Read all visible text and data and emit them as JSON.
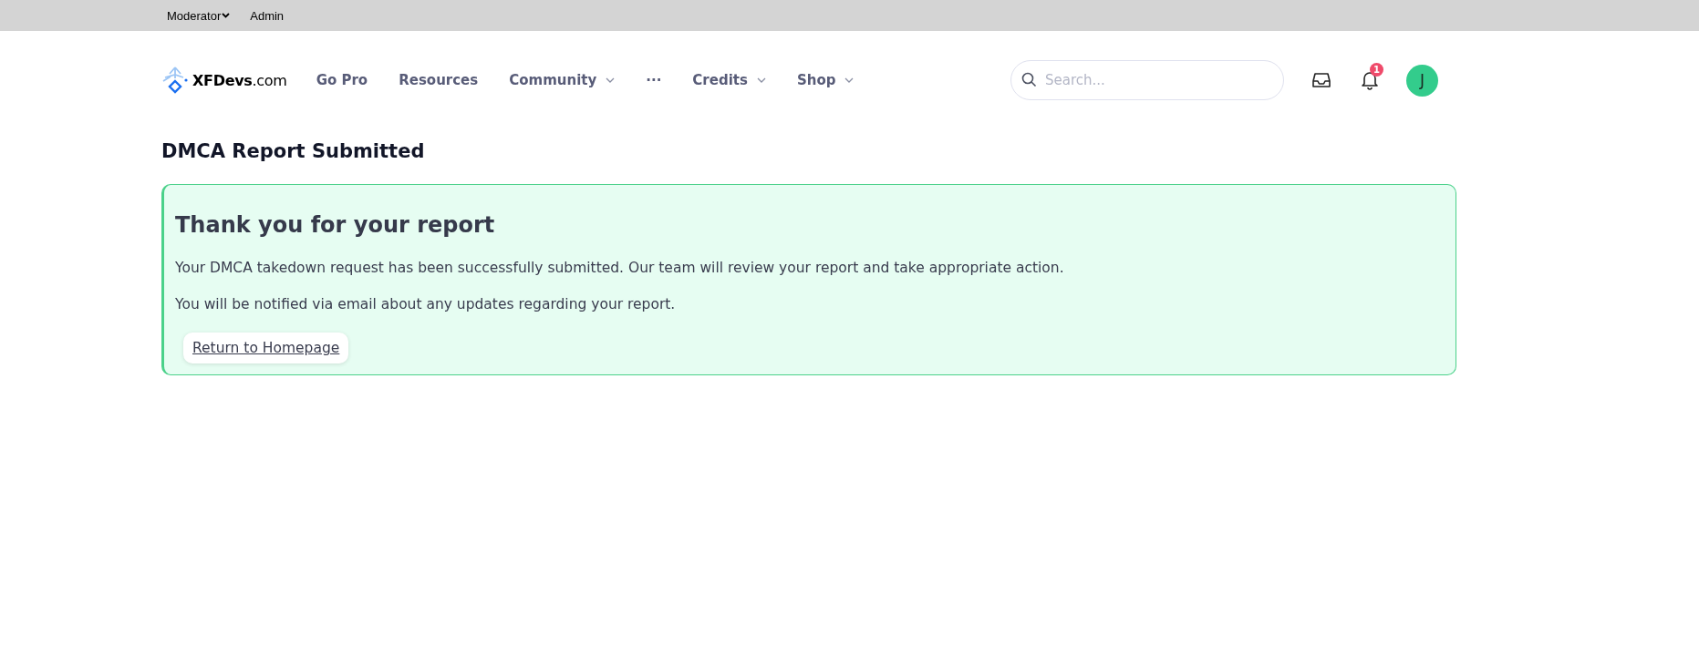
{
  "top_bar": {
    "items": [
      {
        "label": "Moderator",
        "dropdown": true
      },
      {
        "label": "Admin",
        "dropdown": false
      }
    ]
  },
  "header": {
    "logo": {
      "name": "XFDevs",
      "suffix": ".com"
    },
    "nav": [
      {
        "kind": "link",
        "label": "Go Pro",
        "dropdown": false
      },
      {
        "kind": "link",
        "label": "Resources",
        "dropdown": false
      },
      {
        "kind": "link",
        "label": "Community",
        "dropdown": true
      },
      {
        "kind": "more",
        "label": "···"
      },
      {
        "kind": "link",
        "label": "Credits",
        "dropdown": true
      },
      {
        "kind": "link",
        "label": "Shop",
        "dropdown": true
      }
    ],
    "search": {
      "placeholder": "Search..."
    },
    "notifications": {
      "badge": "1"
    },
    "avatar": {
      "initial": "J"
    }
  },
  "page_title": "DMCA Report Submitted",
  "notice": {
    "heading": "Thank you for your report",
    "paragraphs": [
      "Your DMCA takedown request has been successfully submitted. Our team will review your report and take appropriate action.",
      "You will be notified via email about any updates regarding your report."
    ],
    "button": "Return to Homepage"
  }
}
